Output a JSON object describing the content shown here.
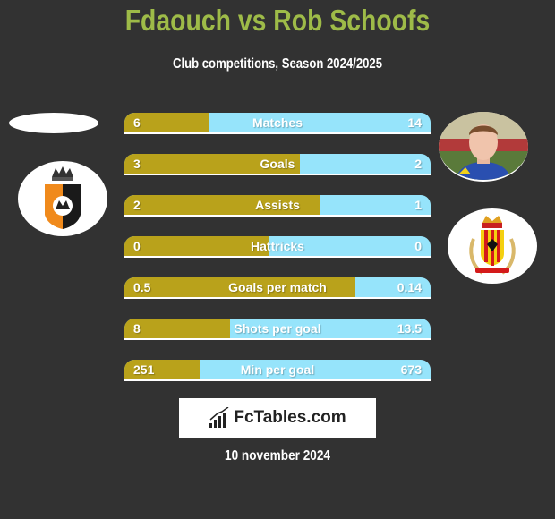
{
  "header": {
    "title": "Fdaouch vs Rob Schoofs",
    "subtitle": "Club competitions, Season 2024/2025"
  },
  "players": {
    "left": {
      "name": "Fdaouch",
      "club_logo": "deinze-shield-logo"
    },
    "right": {
      "name": "Rob Schoofs",
      "photo": "player-photo",
      "club_logo": "kv-mechelen-logo"
    }
  },
  "colors": {
    "title": "#9ebb48",
    "left_bar": "#b9a21b",
    "right_bar": "#96e4fb",
    "background": "#323232"
  },
  "stats": [
    {
      "label": "Matches",
      "left": "6",
      "right": "14",
      "left_num": 6,
      "right_num": 14
    },
    {
      "label": "Goals",
      "left": "3",
      "right": "2",
      "left_num": 3,
      "right_num": 2
    },
    {
      "label": "Assists",
      "left": "2",
      "right": "1",
      "left_num": 2,
      "right_num": 1
    },
    {
      "label": "Hattricks",
      "left": "0",
      "right": "0",
      "left_num": 0,
      "right_num": 0
    },
    {
      "label": "Goals per match",
      "left": "0.5",
      "right": "0.14",
      "left_num": 0.5,
      "right_num": 0.14
    },
    {
      "label": "Shots per goal",
      "left": "8",
      "right": "13.5",
      "left_num": 8,
      "right_num": 13.5
    },
    {
      "label": "Min per goal",
      "left": "251",
      "right": "673",
      "left_num": 251,
      "right_num": 673
    }
  ],
  "brand": {
    "icon": "bar-chart-icon",
    "text": "FcTables.com"
  },
  "date": "10 november 2024"
}
